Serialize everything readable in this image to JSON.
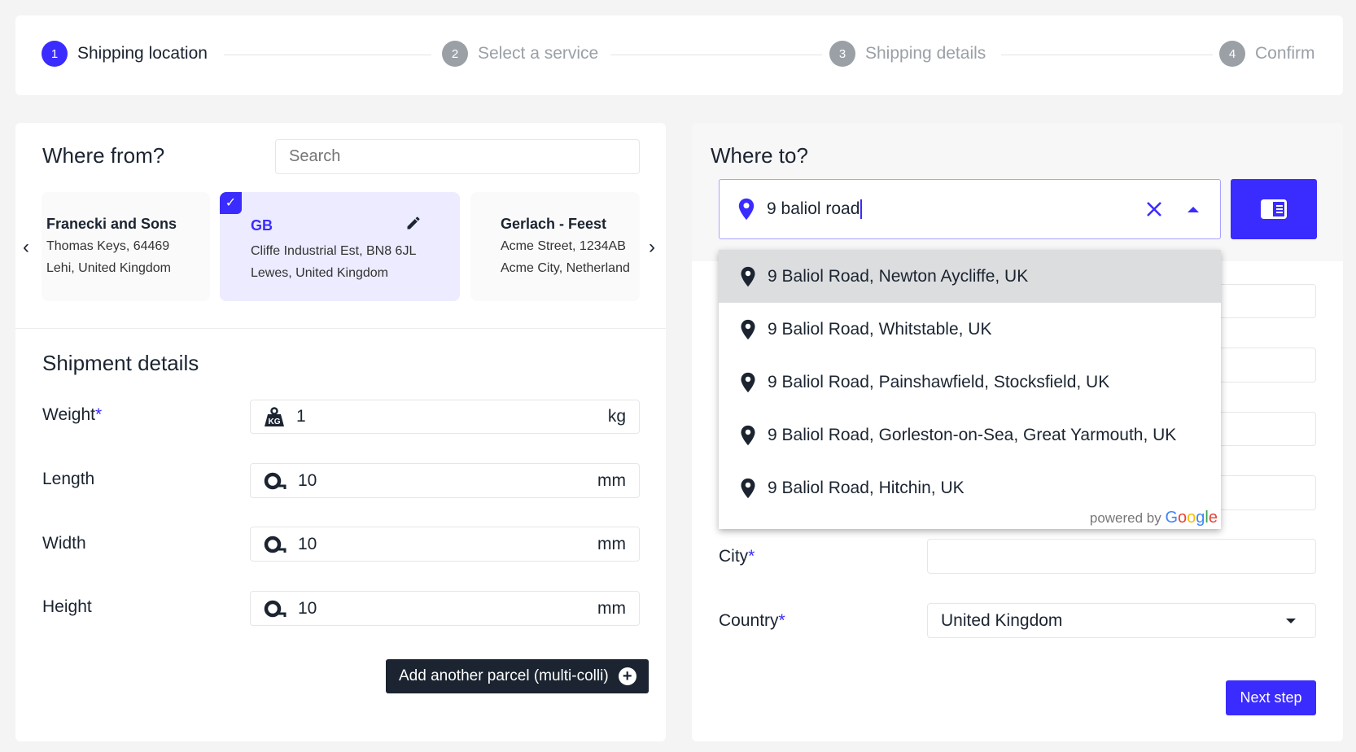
{
  "stepper": [
    {
      "num": "1",
      "label": "Shipping location",
      "active": true
    },
    {
      "num": "2",
      "label": "Select a service"
    },
    {
      "num": "3",
      "label": "Shipping details"
    },
    {
      "num": "4",
      "label": "Confirm"
    }
  ],
  "from": {
    "title": "Where from?",
    "search_placeholder": "Search",
    "cards": [
      {
        "name": "Franecki and Sons",
        "line1": "Thomas Keys, 64469",
        "line2": "Lehi, United Kingdom"
      },
      {
        "name": "GB",
        "line1": "Cliffe Industrial Est, BN8 6JL",
        "line2": "Lewes, United Kingdom",
        "selected": true
      },
      {
        "name": "Gerlach - Feest",
        "line1": "Acme Street, 1234AB",
        "line2": "Acme City, Netherland"
      }
    ]
  },
  "shipment": {
    "title": "Shipment details",
    "fields": [
      {
        "label": "Weight",
        "required": "*",
        "value": "1",
        "unit": "kg",
        "icon": "weight-icon"
      },
      {
        "label": "Length",
        "value": "10",
        "unit": "mm",
        "icon": "tape-measure-icon"
      },
      {
        "label": "Width",
        "value": "10",
        "unit": "mm",
        "icon": "tape-measure-icon"
      },
      {
        "label": "Height",
        "value": "10",
        "unit": "mm",
        "icon": "tape-measure-icon"
      }
    ],
    "add_parcel": "Add another parcel (multi-colli)"
  },
  "to": {
    "title": "Where to?",
    "query": "9 baliol road",
    "suggestions": [
      "9 Baliol Road, Newton Aycliffe, UK",
      "9 Baliol Road, Whitstable, UK",
      "9 Baliol Road, Painshawfield, Stocksfield, UK",
      "9 Baliol Road, Gorleston-on-Sea, Great Yarmouth, UK",
      "9 Baliol Road, Hitchin, UK"
    ],
    "powered_by": "powered by",
    "google": "Google",
    "city_label": "City",
    "city_value": "",
    "country_label": "Country",
    "country_value": "United Kingdom",
    "required": "*",
    "next": "Next step"
  },
  "colors": {
    "accent": "#3a2bff",
    "dark": "#1b2430",
    "selected_card": "#ecebff"
  }
}
